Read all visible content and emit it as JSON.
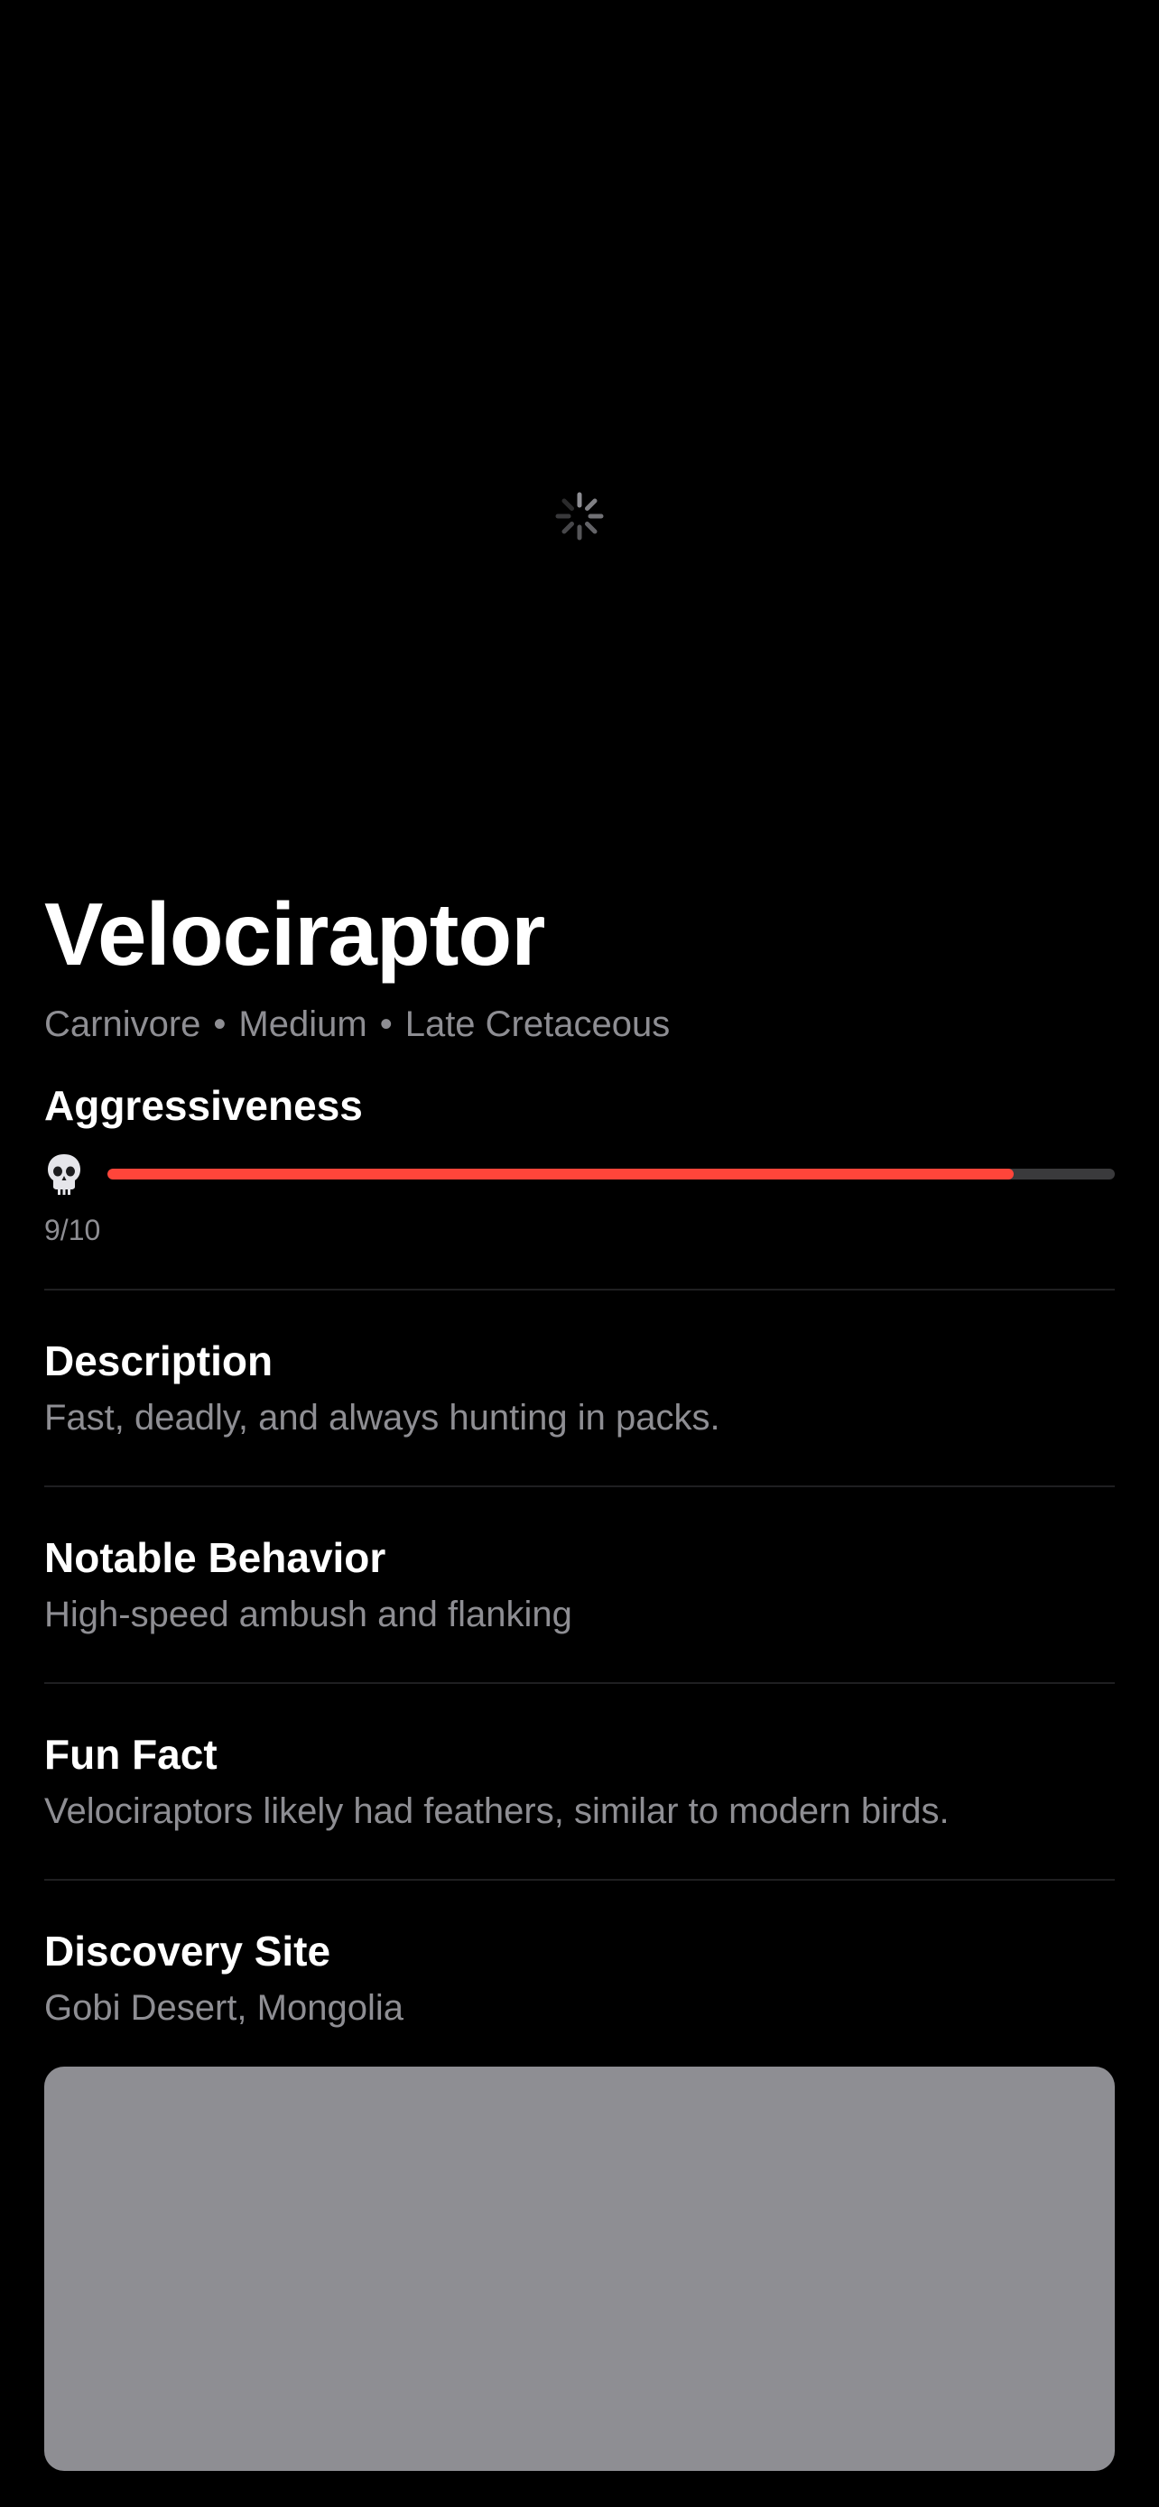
{
  "dino": {
    "name": "Velociraptor",
    "diet": "Carnivore",
    "size": "Medium",
    "period": "Late Cretaceous",
    "separator": "•"
  },
  "aggressiveness": {
    "label": "Aggressiveness",
    "value": 9,
    "max": 10,
    "value_text": "9/10",
    "icon": "skull-icon",
    "fill_color": "#ff453a",
    "track_color": "#3a3a3c",
    "fill_fraction": 0.9
  },
  "sections": {
    "description": {
      "title": "Description",
      "text": "Fast, deadly, and always hunting in packs."
    },
    "behavior": {
      "title": "Notable Behavior",
      "text": "High-speed ambush and flanking"
    },
    "fun_fact": {
      "title": "Fun Fact",
      "text": "Velociraptors likely had feathers, similar to modern birds."
    },
    "discovery": {
      "title": "Discovery Site",
      "text": "Gobi Desert, Mongolia"
    }
  },
  "colors": {
    "background": "#000000",
    "primary_text": "#ffffff",
    "secondary_text": "#8e8e93",
    "map_placeholder": "#8e8e93"
  },
  "hero": {
    "state": "loading",
    "icon": "activity-spinner-icon"
  }
}
